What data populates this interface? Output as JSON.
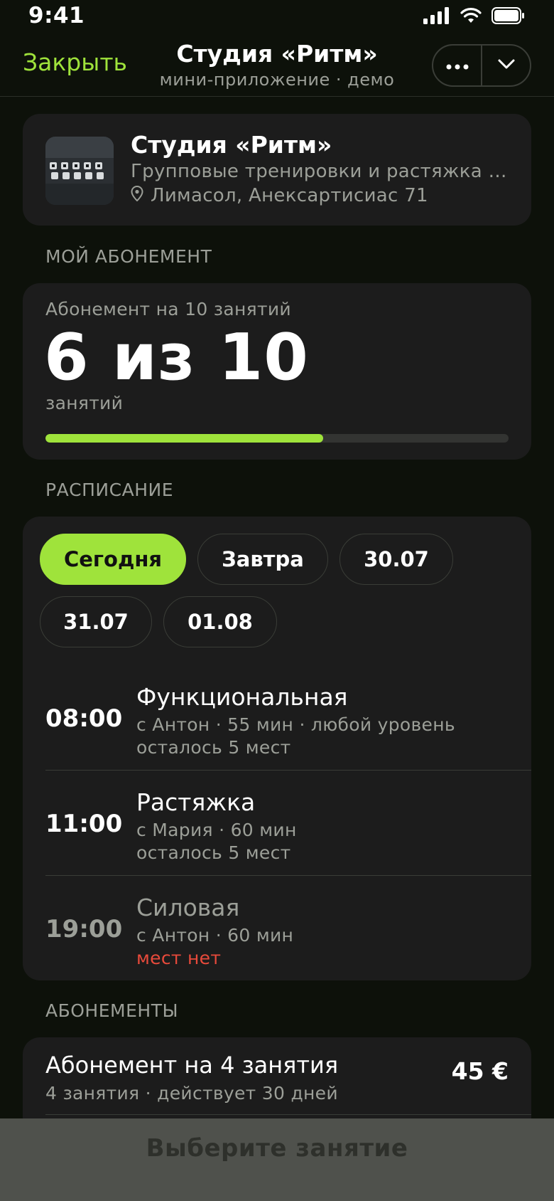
{
  "status_bar": {
    "time": "9:41"
  },
  "header": {
    "close_label": "Закрыть",
    "title": "Студия «Ритм»",
    "subtitle": "мини-приложение · демо"
  },
  "studio": {
    "name": "Студия «Ритм»",
    "description": "Групповые тренировки и растяжка в центре города",
    "location": "Лимасол, Анексартисиас 71"
  },
  "my_subscription": {
    "section_label": "МОЙ АБОНЕМЕНТ",
    "plan_label": "Абонемент на 10 занятий",
    "big_value": "6 из 10",
    "unit": "занятий",
    "used": 6,
    "total": 10
  },
  "schedule": {
    "section_label": "РАСПИСАНИЕ",
    "chips": [
      {
        "label": "Сегодня",
        "active": true
      },
      {
        "label": "Завтра",
        "active": false
      },
      {
        "label": "30.07",
        "active": false
      },
      {
        "label": "31.07",
        "active": false
      },
      {
        "label": "01.08",
        "active": false
      }
    ],
    "slots": [
      {
        "time": "08:00",
        "name": "Функциональная",
        "meta": "с Антон · 55 мин · любой уровень",
        "seats": "осталось 5 мест",
        "full": false
      },
      {
        "time": "11:00",
        "name": "Растяжка",
        "meta": "с Мария · 60 мин",
        "seats": "осталось 5 мест",
        "full": false
      },
      {
        "time": "19:00",
        "name": "Силовая",
        "meta": "с Антон · 60 мин",
        "seats": "мест нет",
        "full": true
      }
    ]
  },
  "plans": {
    "section_label": "АБОНЕМЕНТЫ",
    "items": [
      {
        "name": "Абонемент на 4 занятия",
        "meta": "4 занятия · действует 30 дней",
        "price": "45 €"
      }
    ]
  },
  "bottom_action": {
    "label": "Выберите занятие"
  },
  "colors": {
    "accent": "#9fe33b",
    "danger": "#e84a3b",
    "background": "#0d110a",
    "card": "#1c1c1c"
  }
}
